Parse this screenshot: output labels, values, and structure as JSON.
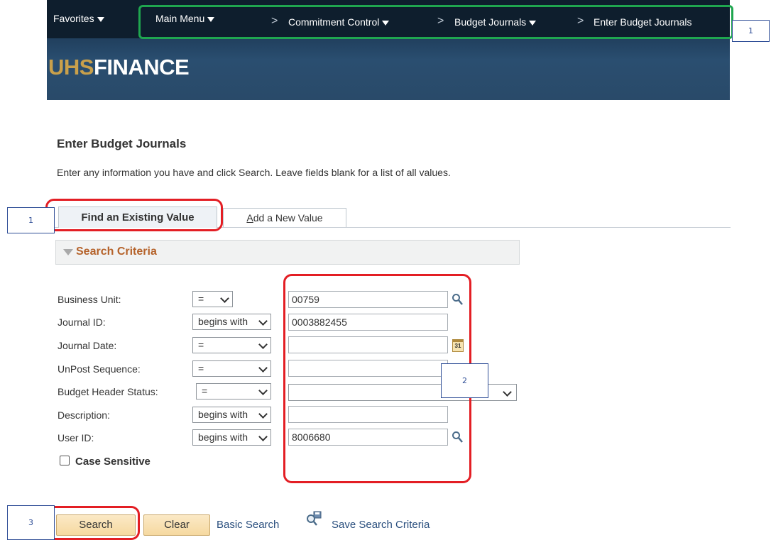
{
  "nav": {
    "favorites": "Favorites",
    "main_menu": "Main Menu",
    "breadcrumbs": [
      "Commitment Control",
      "Budget Journals",
      "Enter Budget Journals"
    ],
    "separator": ">"
  },
  "logo": {
    "part1": "UHS",
    "part2": "FINANCE"
  },
  "page": {
    "title": "Enter Budget Journals",
    "instructions": "Enter any information you have and click Search. Leave fields blank for a list of all values."
  },
  "tabs": {
    "find_existing": "Find an Existing Value",
    "add_new_first": "A",
    "add_new_rest": "dd a New Value"
  },
  "search_criteria": {
    "title": "Search Criteria",
    "fields": [
      {
        "label": "Business Unit:",
        "operator": "=",
        "value": "00759"
      },
      {
        "label": "Journal ID:",
        "operator": "begins with",
        "value": "0003882455"
      },
      {
        "label": "Journal Date:",
        "operator": "=",
        "value": ""
      },
      {
        "label": "UnPost Sequence:",
        "operator": "=",
        "value": ""
      },
      {
        "label": "Budget Header Status:",
        "operator": "=",
        "value": ""
      },
      {
        "label": "Description:",
        "operator": "begins with",
        "value": ""
      },
      {
        "label": "User ID:",
        "operator": "begins with",
        "value": "8006680"
      }
    ],
    "case_sensitive": "Case Sensitive",
    "calendar_text": "31"
  },
  "buttons": {
    "search": "Search",
    "clear": "Clear",
    "basic_search": "Basic Search",
    "save_criteria": "Save Search Criteria"
  },
  "annotations": {
    "nav": "1",
    "tab": "1",
    "fields": "2",
    "search": "3"
  },
  "colors": {
    "nav_bar": "#0e1e2d",
    "banner": "#1f3d5b",
    "logo_accent": "#c9a04b",
    "criteria_title": "#b5622a",
    "button": "#f6d9a0",
    "annotation_red": "#e31e24",
    "annotation_green": "#1fa64f"
  }
}
